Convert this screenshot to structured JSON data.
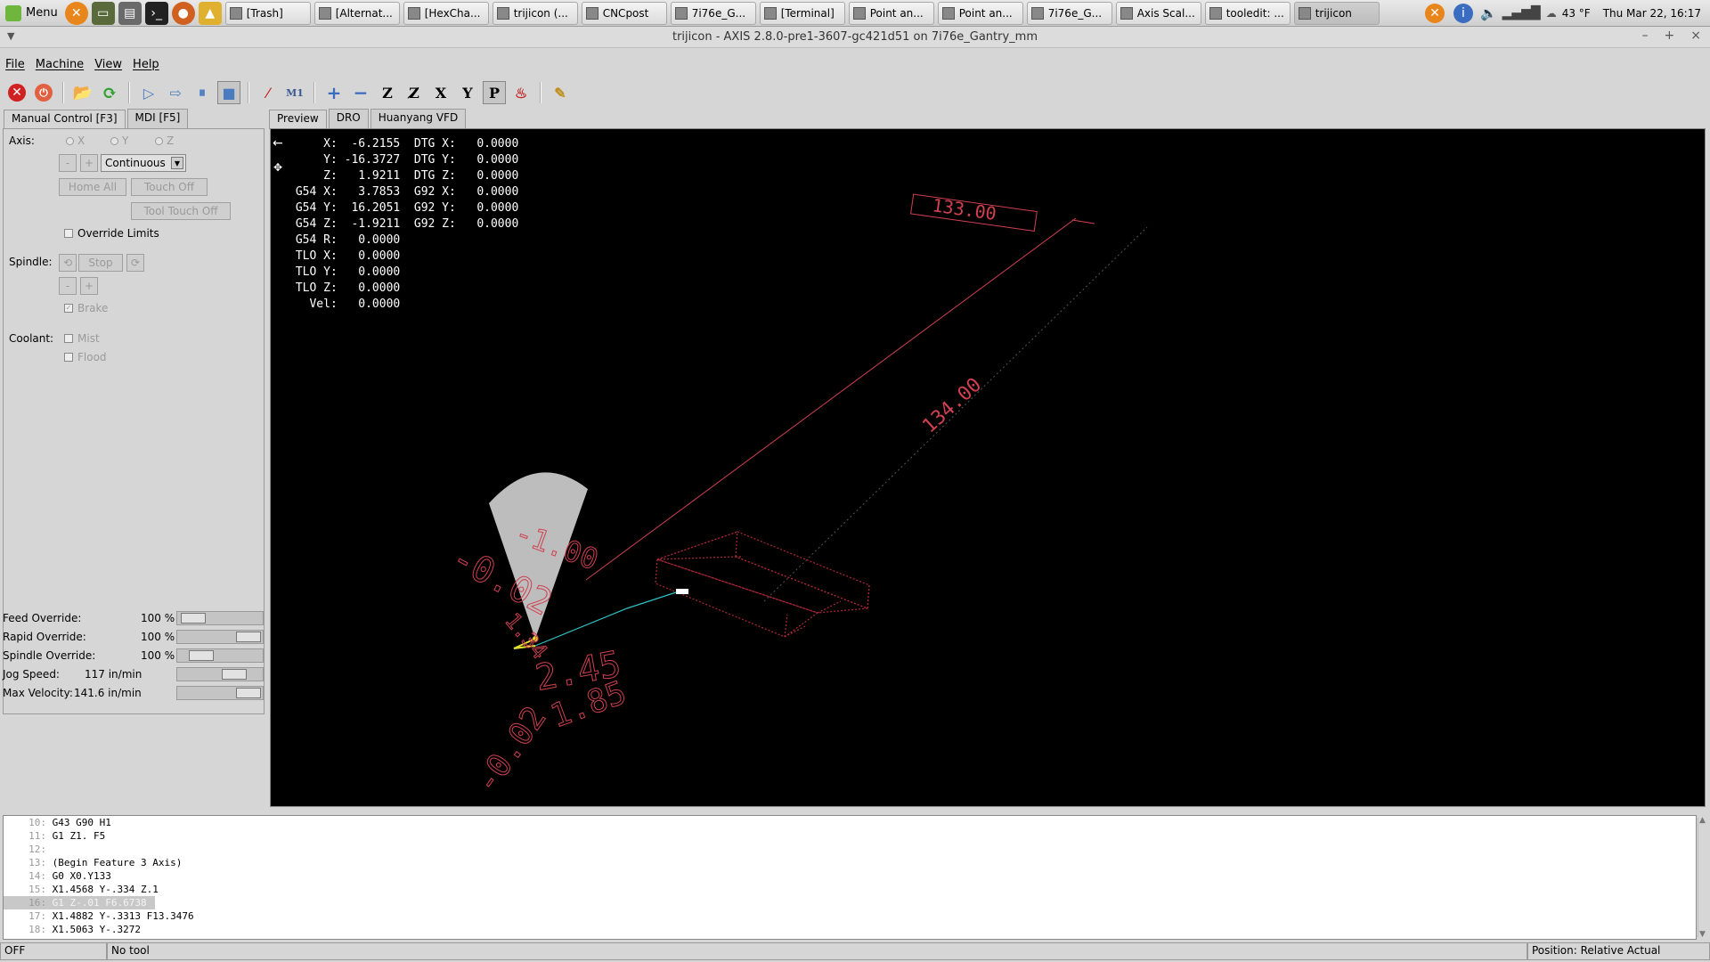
{
  "taskbar": {
    "menu_label": "Menu",
    "windows": [
      {
        "label": "[Trash]",
        "active": false
      },
      {
        "label": "[Alternat...",
        "active": false
      },
      {
        "label": "[HexCha...",
        "active": false
      },
      {
        "label": "trijicon (...",
        "active": false
      },
      {
        "label": "CNCpost",
        "active": false
      },
      {
        "label": "7i76e_G...",
        "active": false
      },
      {
        "label": "[Terminal]",
        "active": false
      },
      {
        "label": "Point an...",
        "active": false
      },
      {
        "label": "Point an...",
        "active": false
      },
      {
        "label": "7i76e_G...",
        "active": false
      },
      {
        "label": "Axis Scal...",
        "active": false
      },
      {
        "label": "tooledit: ...",
        "active": false
      },
      {
        "label": "trijicon",
        "active": true
      }
    ],
    "weather": "43 °F",
    "clock": "Thu Mar 22, 16:17"
  },
  "window": {
    "title": "trijicon - AXIS 2.8.0-pre1-3607-gc421d51 on 7i76e_Gantry_mm"
  },
  "menubar": [
    "File",
    "Machine",
    "View",
    "Help"
  ],
  "left_tabs": [
    "Manual Control [F3]",
    "MDI [F5]"
  ],
  "manual": {
    "axis_label": "Axis:",
    "axes": [
      "X",
      "Y",
      "Z"
    ],
    "minus": "-",
    "plus": "+",
    "jog_mode": "Continuous",
    "home_all": "Home All",
    "touch_off": "Touch Off",
    "tool_touch_off": "Tool Touch Off",
    "override_limits": "Override Limits",
    "spindle_label": "Spindle:",
    "spindle_stop": "Stop",
    "brake": "Brake",
    "coolant_label": "Coolant:",
    "mist": "Mist",
    "flood": "Flood"
  },
  "overrides": [
    {
      "label": "Feed Override:",
      "value": "100 %",
      "fraction": 0.06
    },
    {
      "label": "Rapid Override:",
      "value": "100 %",
      "fraction": 1.0
    },
    {
      "label": "Spindle Override:",
      "value": "100 %",
      "fraction": 0.2
    },
    {
      "label": "Jog Speed:",
      "value": "117 in/min",
      "fraction": 0.75
    },
    {
      "label": "Max Velocity:",
      "value": "141.6 in/min",
      "fraction": 1.0
    }
  ],
  "preview_tabs": [
    "Preview",
    "DRO",
    "Huanyang VFD"
  ],
  "dro": {
    "lines": [
      "     X:  -6.2155  DTG X:   0.0000",
      "     Y: -16.3727  DTG Y:   0.0000",
      "     Z:   1.9211  DTG Z:   0.0000",
      " G54 X:   3.7853  G92 X:   0.0000",
      " G54 Y:  16.2051  G92 Y:   0.0000",
      " G54 Z:  -1.9211  G92 Z:   0.0000",
      " G54 R:   0.0000",
      " TLO X:   0.0000",
      " TLO Y:   0.0000",
      " TLO Z:   0.0000",
      "   Vel:   0.0000"
    ]
  },
  "dims": {
    "d1": "133.00",
    "d2": "134.00",
    "d3": "-1.00",
    "d4": "-0.02",
    "d5": "1.34",
    "d6": "2.45",
    "d7": "1.85",
    "d8": "-0.02"
  },
  "gcode": [
    {
      "n": "10:",
      "code": "G43 G90 H1"
    },
    {
      "n": "11:",
      "code": "G1 Z1. F5"
    },
    {
      "n": "12:",
      "code": ""
    },
    {
      "n": "13:",
      "code": "(Begin Feature 3 Axis)"
    },
    {
      "n": "14:",
      "code": "G0 X0.Y133"
    },
    {
      "n": "15:",
      "code": "X1.4568 Y-.334 Z.1"
    },
    {
      "n": "16:",
      "code": "G1 Z-.01 F6.6738",
      "hl": true
    },
    {
      "n": "17:",
      "code": "X1.4882 Y-.3313 F13.3476"
    },
    {
      "n": "18:",
      "code": "X1.5063 Y-.3272"
    }
  ],
  "status": {
    "state": "OFF",
    "tool": "No tool",
    "position": "Position: Relative Actual"
  }
}
